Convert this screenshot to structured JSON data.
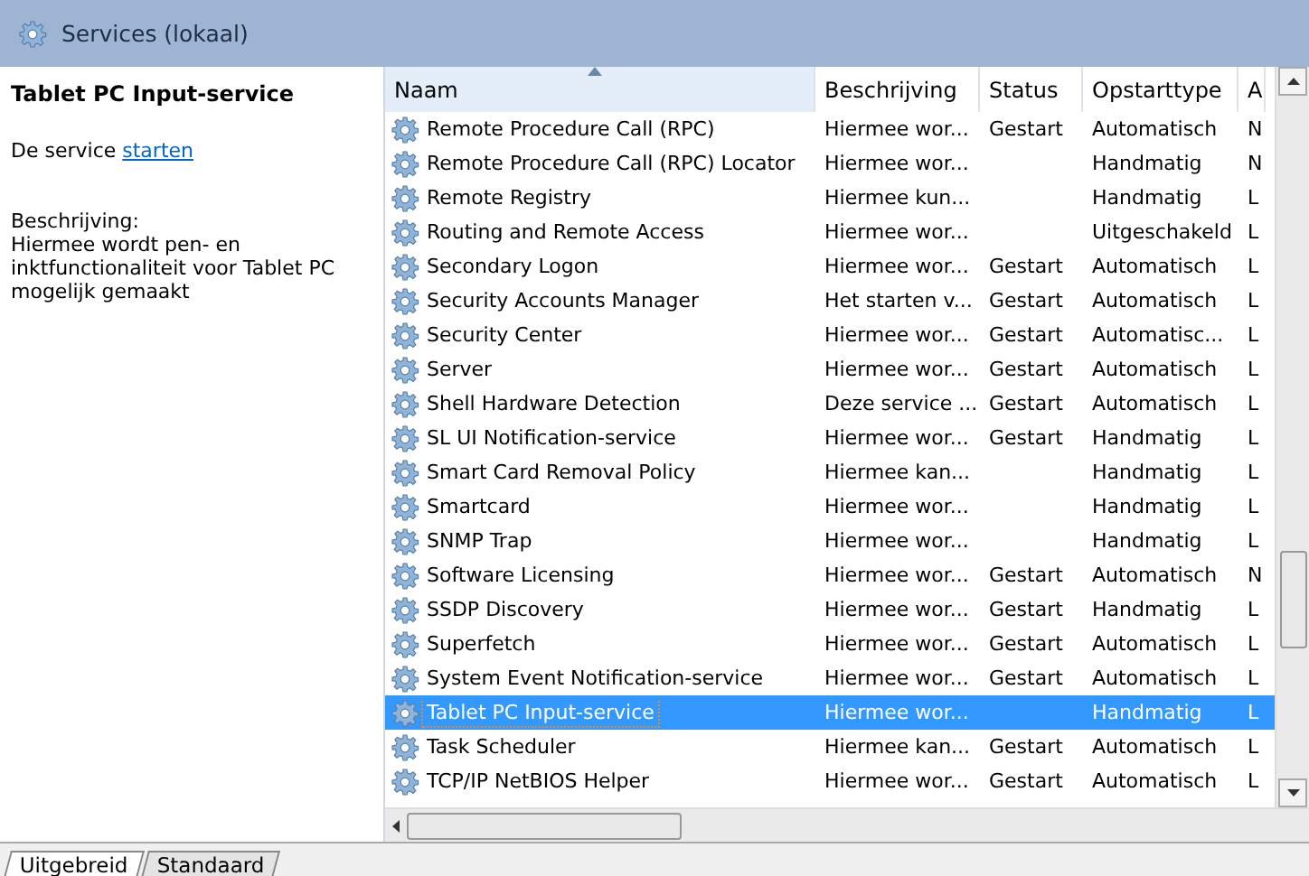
{
  "header": {
    "title": "Services (lokaal)"
  },
  "details": {
    "name": "Tablet PC Input-service",
    "action_prefix": "De service",
    "action_link": "starten",
    "description_label": "Beschrijving:",
    "description": "Hiermee wordt pen- en inktfunctionaliteit voor Tablet PC mogelijk gemaakt"
  },
  "table": {
    "columns": [
      "Naam",
      "Beschrijving",
      "Status",
      "Opstarttype",
      "A"
    ],
    "rows": [
      {
        "name": "Remote Procedure Call (RPC)",
        "description": "Hiermee wor...",
        "status": "Gestart",
        "startup": "Automatisch",
        "column_5": "N",
        "selected": false
      },
      {
        "name": "Remote Procedure Call (RPC) Locator",
        "description": "Hiermee wor...",
        "status": "",
        "startup": "Handmatig",
        "column_5": "N",
        "selected": false
      },
      {
        "name": "Remote Registry",
        "description": "Hiermee kun...",
        "status": "",
        "startup": "Handmatig",
        "column_5": "L",
        "selected": false
      },
      {
        "name": "Routing and Remote Access",
        "description": "Hiermee wor...",
        "status": "",
        "startup": "Uitgeschakeld",
        "column_5": "L",
        "selected": false
      },
      {
        "name": "Secondary Logon",
        "description": "Hiermee wor...",
        "status": "Gestart",
        "startup": "Automatisch",
        "column_5": "L",
        "selected": false
      },
      {
        "name": "Security Accounts Manager",
        "description": "Het starten v...",
        "status": "Gestart",
        "startup": "Automatisch",
        "column_5": "L",
        "selected": false
      },
      {
        "name": "Security Center",
        "description": "Hiermee wor...",
        "status": "Gestart",
        "startup": "Automatisc...",
        "column_5": "L",
        "selected": false
      },
      {
        "name": "Server",
        "description": "Hiermee wor...",
        "status": "Gestart",
        "startup": "Automatisch",
        "column_5": "L",
        "selected": false
      },
      {
        "name": "Shell Hardware Detection",
        "description": "Deze service ...",
        "status": "Gestart",
        "startup": "Automatisch",
        "column_5": "L",
        "selected": false
      },
      {
        "name": "SL UI Notification-service",
        "description": "Hiermee wor...",
        "status": "Gestart",
        "startup": "Handmatig",
        "column_5": "L",
        "selected": false
      },
      {
        "name": "Smart Card Removal Policy",
        "description": "Hiermee kan...",
        "status": "",
        "startup": "Handmatig",
        "column_5": "L",
        "selected": false
      },
      {
        "name": "Smartcard",
        "description": "Hiermee wor...",
        "status": "",
        "startup": "Handmatig",
        "column_5": "L",
        "selected": false
      },
      {
        "name": "SNMP Trap",
        "description": "Hiermee wor...",
        "status": "",
        "startup": "Handmatig",
        "column_5": "L",
        "selected": false
      },
      {
        "name": "Software Licensing",
        "description": "Hiermee wor...",
        "status": "Gestart",
        "startup": "Automatisch",
        "column_5": "N",
        "selected": false
      },
      {
        "name": "SSDP Discovery",
        "description": "Hiermee wor...",
        "status": "Gestart",
        "startup": "Handmatig",
        "column_5": "L",
        "selected": false
      },
      {
        "name": "Superfetch",
        "description": "Hiermee wor...",
        "status": "Gestart",
        "startup": "Automatisch",
        "column_5": "L",
        "selected": false
      },
      {
        "name": "System Event Notification-service",
        "description": "Hiermee wor...",
        "status": "Gestart",
        "startup": "Automatisch",
        "column_5": "L",
        "selected": false
      },
      {
        "name": "Tablet PC Input-service",
        "description": "Hiermee wor...",
        "status": "",
        "startup": "Handmatig",
        "column_5": "L",
        "selected": true
      },
      {
        "name": "Task Scheduler",
        "description": "Hiermee kan...",
        "status": "Gestart",
        "startup": "Automatisch",
        "column_5": "L",
        "selected": false
      },
      {
        "name": "TCP/IP NetBIOS Helper",
        "description": "Hiermee wor...",
        "status": "Gestart",
        "startup": "Automatisch",
        "column_5": "L",
        "selected": false
      }
    ]
  },
  "tabs": [
    {
      "label": "Uitgebreid",
      "selected": true
    },
    {
      "label": "Standaard",
      "selected": false
    }
  ]
}
